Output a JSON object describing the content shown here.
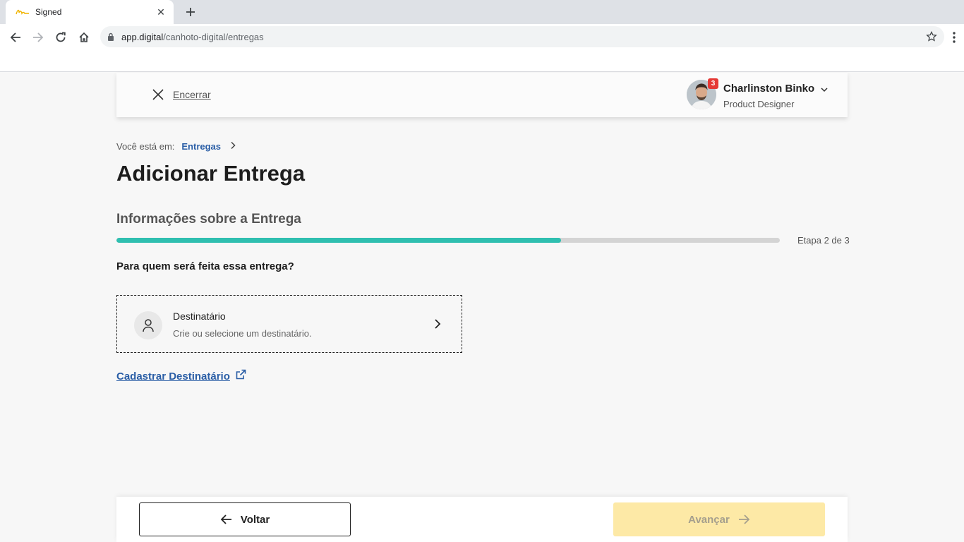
{
  "browser": {
    "tab_title": "Signed",
    "url_host": "app.digital",
    "url_path": "/canhoto-digital/entregas"
  },
  "header": {
    "close_label": "Encerrar",
    "notifications_count": "3",
    "user_name": "Charlinston Binko",
    "user_role": "Product Designer"
  },
  "breadcrumb": {
    "prefix": "Você está em:",
    "link": "Entregas"
  },
  "page_title": "Adicionar Entrega",
  "section_title": "Informações sobre a Entrega",
  "progress": {
    "fraction": 0.67,
    "step_label": "Etapa 2 de 3"
  },
  "question": "Para quem será feita essa entrega?",
  "recipient_card": {
    "title": "Destinatário",
    "subtitle": "Crie ou selecione um destinatário."
  },
  "register_link": "Cadastrar Destinatário",
  "footer": {
    "back_label": "Voltar",
    "next_label": "Avançar"
  },
  "colors": {
    "accent_teal": "#2fbfb0",
    "link_blue": "#2a5ea6",
    "next_disabled_bg": "#fde9a6",
    "notification_red": "#e53935"
  }
}
